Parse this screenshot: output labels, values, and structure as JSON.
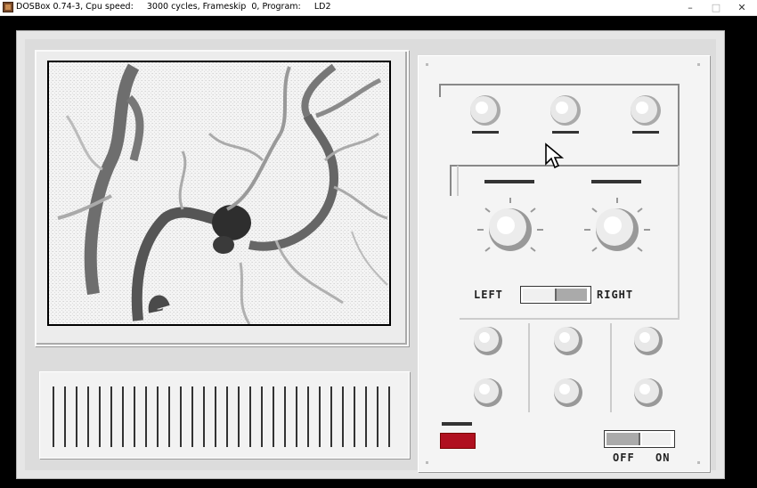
{
  "window": {
    "title": "DOSBox 0.74-3, Cpu speed:     3000 cycles, Frameskip  0, Program:     LD2",
    "minimize_glyph": "–",
    "maximize_glyph": "□",
    "close_glyph": "✕"
  },
  "controls": {
    "balance_left_label": "LEFT",
    "balance_right_label": "RIGHT",
    "power_off_label": "OFF",
    "power_on_label": "ON"
  },
  "colors": {
    "power_light": "#b01020",
    "panel": "#f4f4f4",
    "bezel": "#e6e6e6"
  }
}
